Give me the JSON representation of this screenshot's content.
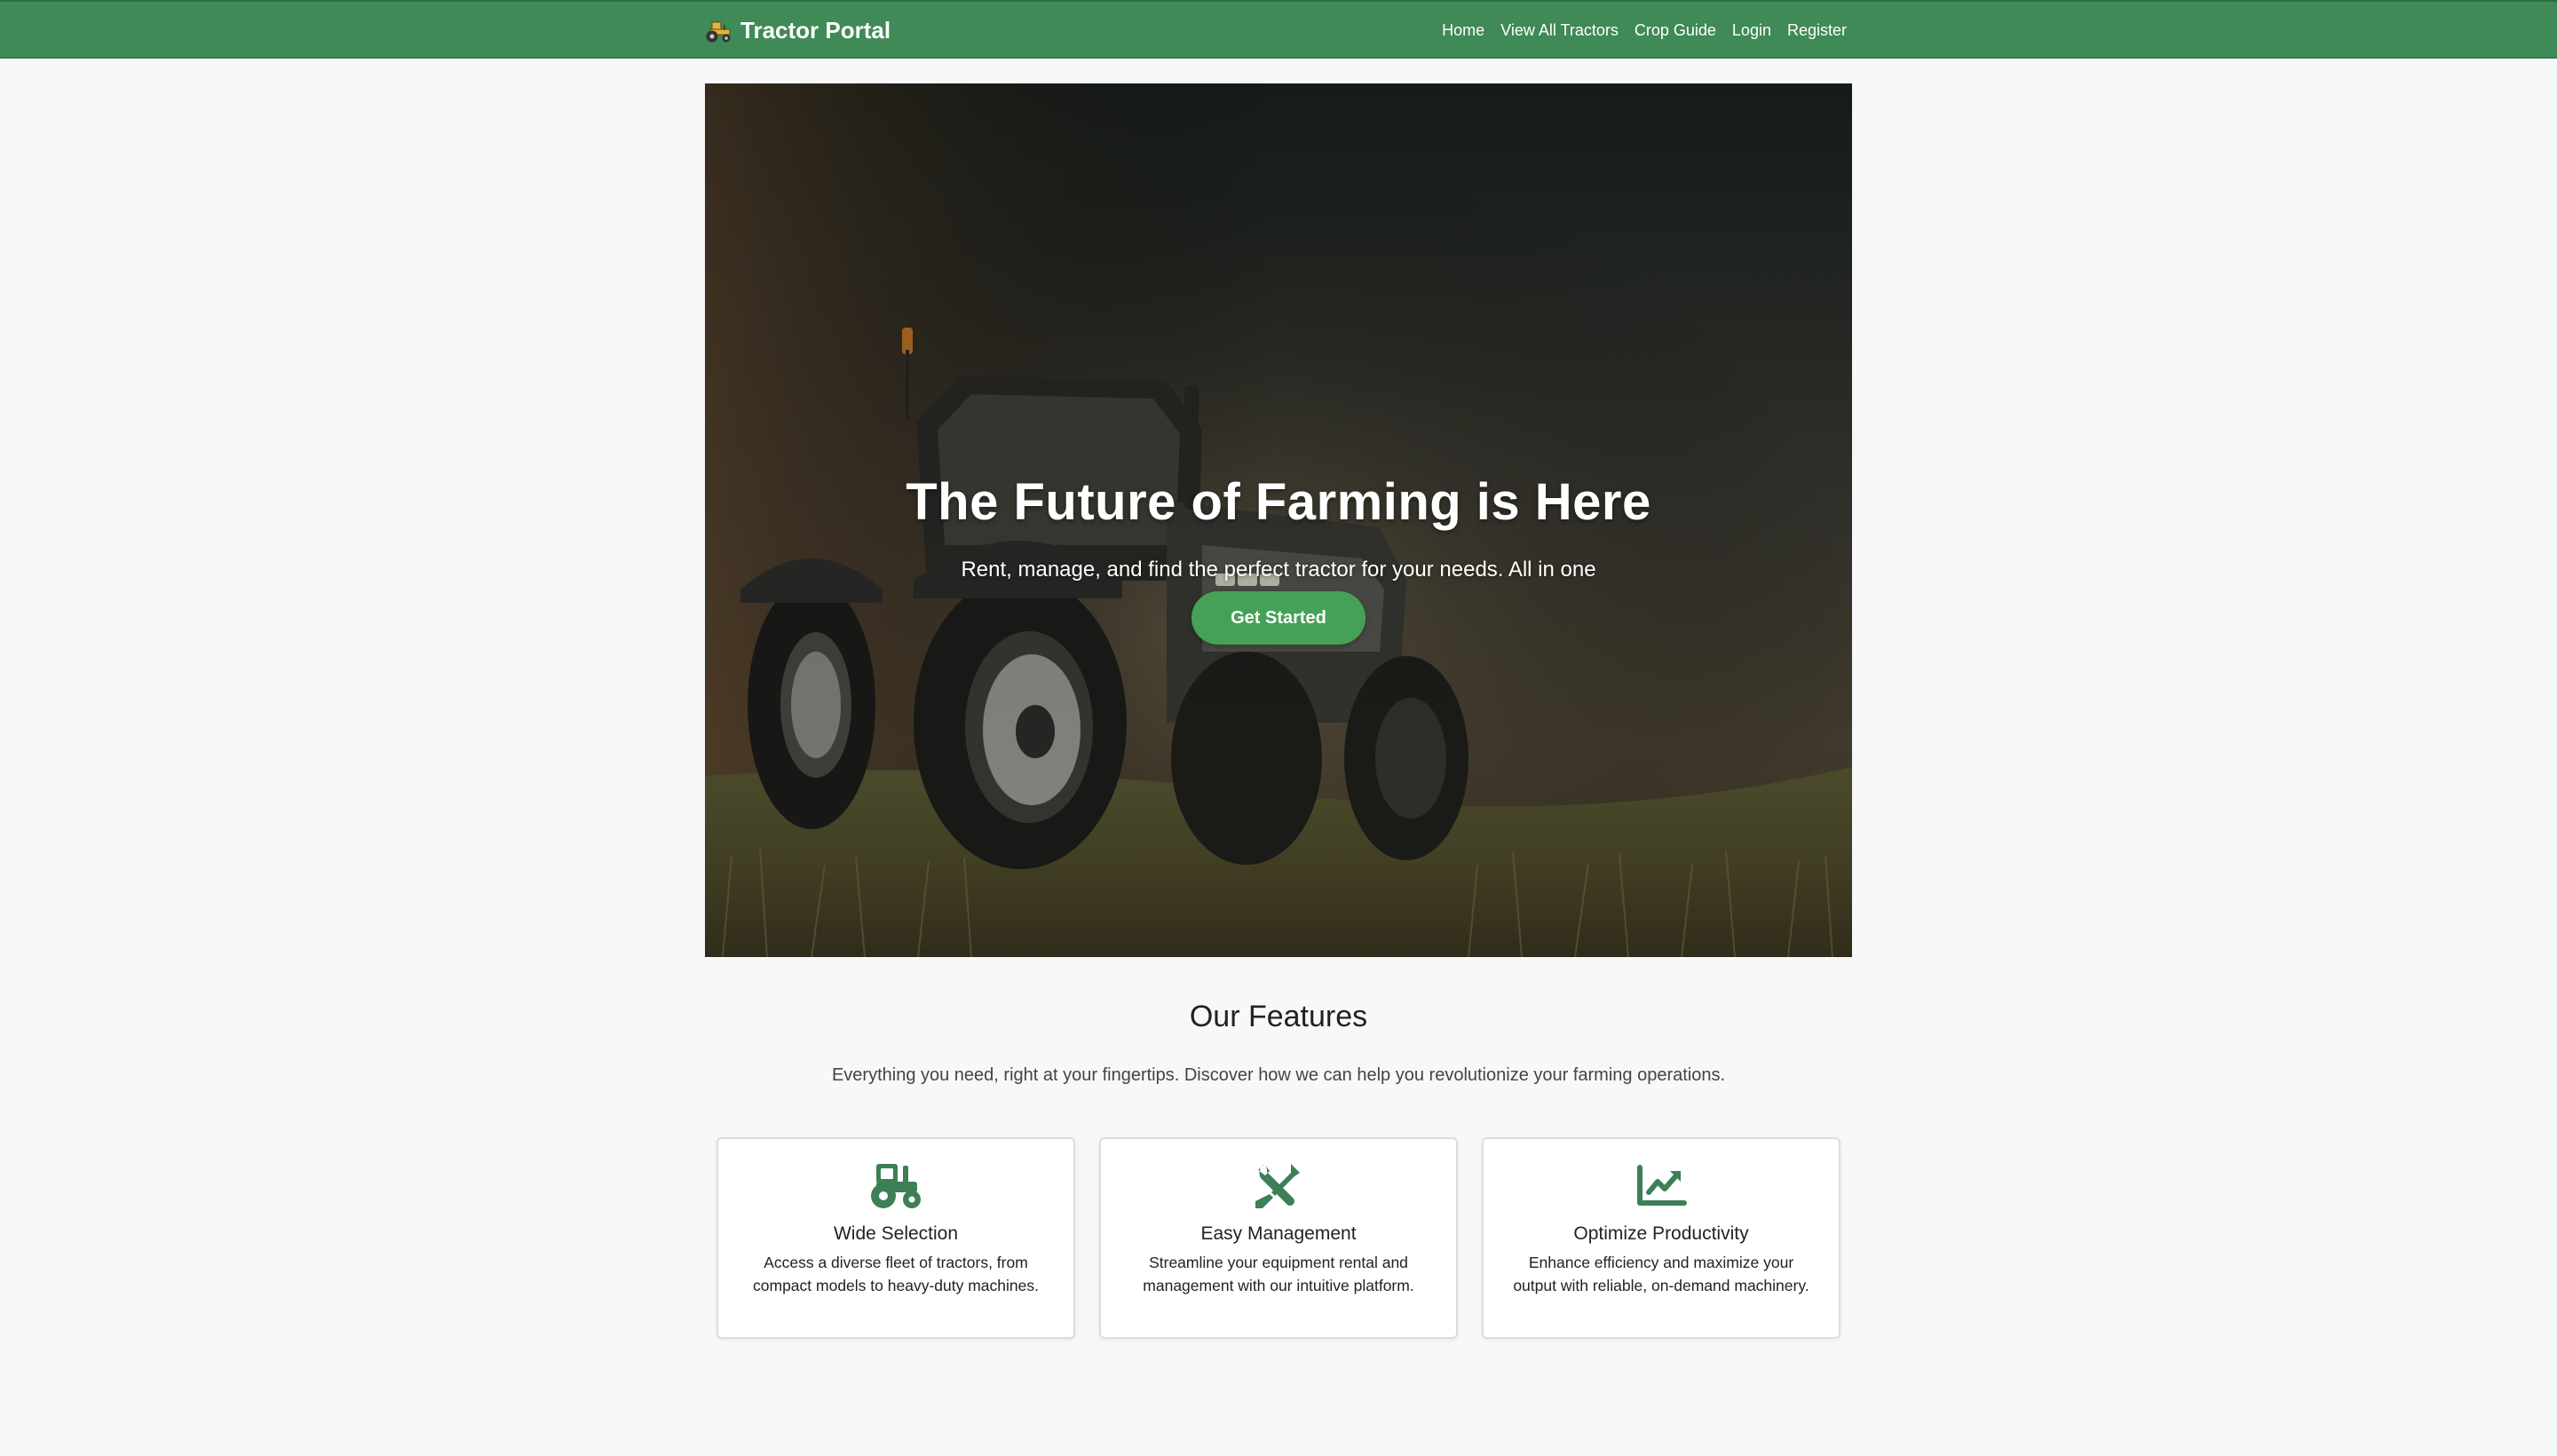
{
  "navbar": {
    "brand": "Tractor Portal",
    "brand_icon": "tractor-emoji-icon",
    "links": [
      "Home",
      "View All Tractors",
      "Crop Guide",
      "Login",
      "Register"
    ]
  },
  "hero": {
    "title": "The Future of Farming is Here",
    "subtitle": "Rent, manage, and find the perfect tractor for your needs. All in one place.",
    "cta_label": "Get Started"
  },
  "features": {
    "title": "Our Features",
    "subtitle": "Everything you need, right at your fingertips. Discover how we can help you revolutionize your farming operations.",
    "cards": [
      {
        "icon": "tractor-icon",
        "title": "Wide Selection",
        "description": "Access a diverse fleet of tractors, from compact models to heavy-duty machines."
      },
      {
        "icon": "tools-icon",
        "title": "Easy Management",
        "description": "Streamline your equipment rental and management with our intuitive platform."
      },
      {
        "icon": "chart-line-icon",
        "title": "Optimize Productivity",
        "description": "Enhance efficiency and maximize your output with reliable, on-demand machinery."
      }
    ]
  },
  "colors": {
    "navbar_green": "#3f8a56",
    "cta_green": "#45a157",
    "icon_green": "#3d7f57",
    "page_bg": "#f7f8fa"
  }
}
